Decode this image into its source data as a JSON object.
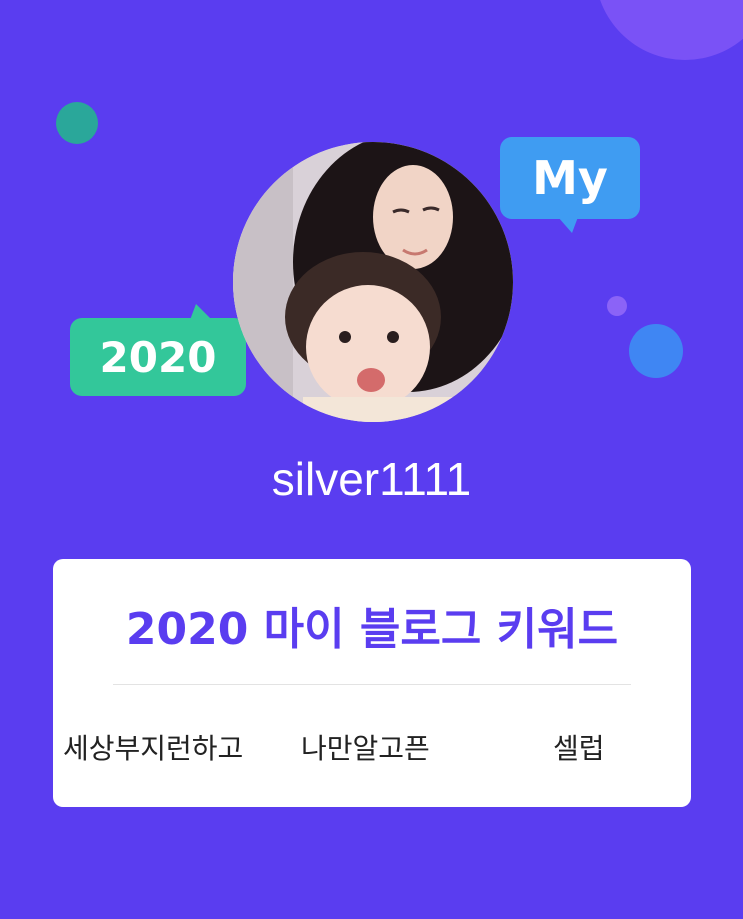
{
  "header": {
    "bubble_my": "My",
    "bubble_year": "2020"
  },
  "profile": {
    "username": "silver1111"
  },
  "card": {
    "title": "2020 마이 블로그 키워드",
    "keywords": [
      "세상부지런하고",
      "나만알고픈",
      "셀럽"
    ]
  },
  "colors": {
    "background": "#5a3df0",
    "title": "#5a3df0",
    "bubble_my": "#3f9cf2",
    "bubble_year": "#33c79a"
  }
}
